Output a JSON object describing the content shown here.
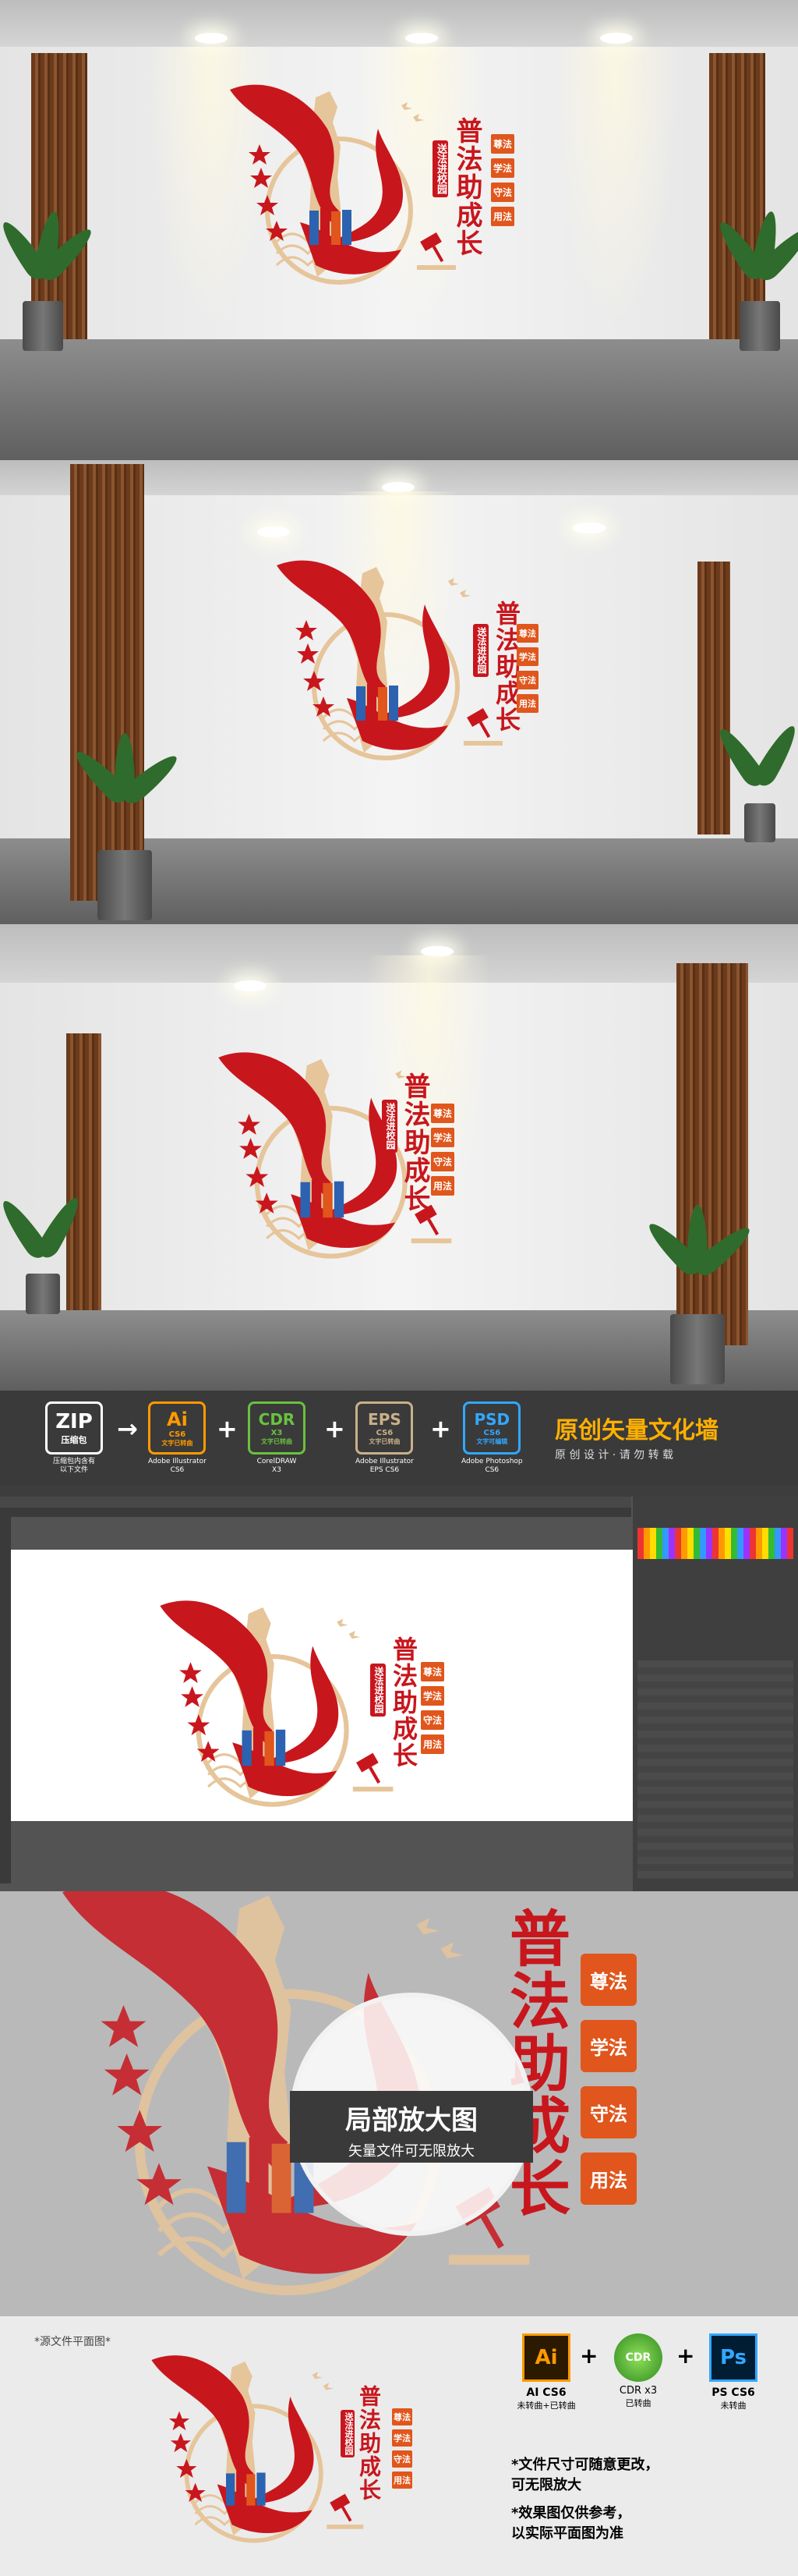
{
  "artwork": {
    "title": "普法助成长",
    "subtitle": "送法进校园",
    "tags": [
      "尊法",
      "学法",
      "守法",
      "用法"
    ]
  },
  "formats": {
    "zip": {
      "label": "ZIP",
      "sub": "压缩包",
      "caption": "压缩包内含有\n以下文件"
    },
    "ai": {
      "label": "Ai",
      "ver": "CS6",
      "note": "文字已转曲",
      "caption": "Adobe Illustrator\nCS6"
    },
    "cdr": {
      "label": "CDR",
      "ver": "X3",
      "note": "文字已转曲",
      "caption": "CorelDRAW\nX3"
    },
    "eps": {
      "label": "EPS",
      "ver": "CS6",
      "note": "文字已转曲",
      "caption": "Adobe Illustrator\nEPS CS6"
    },
    "psd": {
      "label": "PSD",
      "ver": "CS6",
      "note": "文字可编辑",
      "caption": "Adobe Photoshop\nCS6"
    }
  },
  "banner": {
    "title": "原创矢量文化墙",
    "subtitle": "原 创 设 计 · 请 勿 转 载"
  },
  "zoom": {
    "title": "局部放大图",
    "subtitle": "矢量文件可无限放大"
  },
  "flat": {
    "label": "*源文件平面图*"
  },
  "bottom_formats": [
    {
      "icon": "Ai",
      "name": "AI CS6",
      "note": "未转曲+已转曲",
      "color": "#ff9a00"
    },
    {
      "icon": "CDR",
      "name": "CDR x3",
      "note": "已转曲",
      "color": "#4aa72f"
    },
    {
      "icon": "Ps",
      "name": "PS CS6",
      "note": "未转曲",
      "color": "#31a8ff"
    }
  ],
  "notes": [
    "*文件尺寸可随意更改，\n可无限放大",
    "*效果图仅供参考，\n以实际平面图为准"
  ],
  "colors": {
    "red": "#c8161d",
    "orange": "#e0561c",
    "tan": "#e6c59a"
  }
}
